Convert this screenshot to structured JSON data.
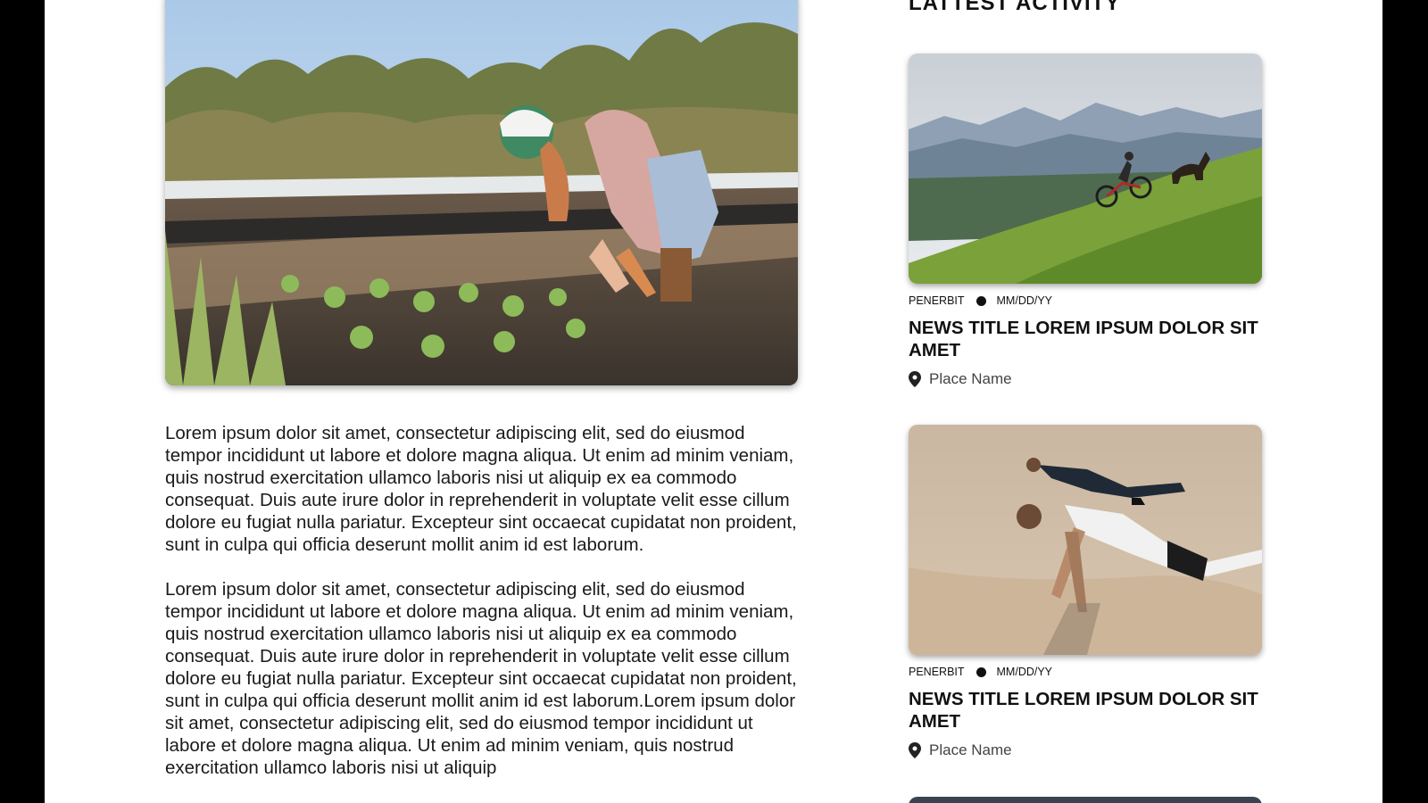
{
  "sidebar": {
    "title": "LATTEST ACTIVITY",
    "cards": [
      {
        "image_icon": "mountain-bike-photo",
        "source": "PENERBIT",
        "date": "MM/DD/YY",
        "title": "NEWS TITLE LOREM IPSUM DOLOR SIT AMET",
        "place_icon": "map-pin-icon",
        "place": "Place Name"
      },
      {
        "image_icon": "beach-pushup-photo",
        "source": "PENERBIT",
        "date": "MM/DD/YY",
        "title": "NEWS TITLE LOREM IPSUM DOLOR SIT AMET",
        "place_icon": "map-pin-icon",
        "place": "Place Name"
      }
    ]
  },
  "article": {
    "hero_icon": "farmer-planting-photo",
    "paragraphs": [
      "Lorem ipsum dolor sit amet, consectetur adipiscing elit, sed do eiusmod tempor incididunt ut labore et dolore magna aliqua. Ut enim ad minim veniam, quis nostrud exercitation ullamco laboris nisi ut aliquip ex ea commodo consequat. Duis aute irure dolor in reprehenderit in voluptate velit esse cillum dolore eu fugiat nulla pariatur. Excepteur sint occaecat cupidatat non proident, sunt in culpa qui officia deserunt mollit anim id est laborum.",
      "Lorem ipsum dolor sit amet, consectetur adipiscing elit, sed do eiusmod tempor incididunt ut labore et dolore magna aliqua. Ut enim ad minim veniam, quis nostrud exercitation ullamco laboris nisi ut aliquip ex ea commodo consequat. Duis aute irure dolor in reprehenderit in voluptate velit esse cillum dolore eu fugiat nulla pariatur. Excepteur sint occaecat cupidatat non proident, sunt in culpa qui officia deserunt mollit anim id est laborum.Lorem ipsum dolor sit amet, consectetur adipiscing elit, sed do eiusmod tempor incididunt ut labore et dolore magna aliqua. Ut enim ad minim veniam, quis nostrud exercitation ullamco laboris nisi ut aliquip"
    ]
  }
}
